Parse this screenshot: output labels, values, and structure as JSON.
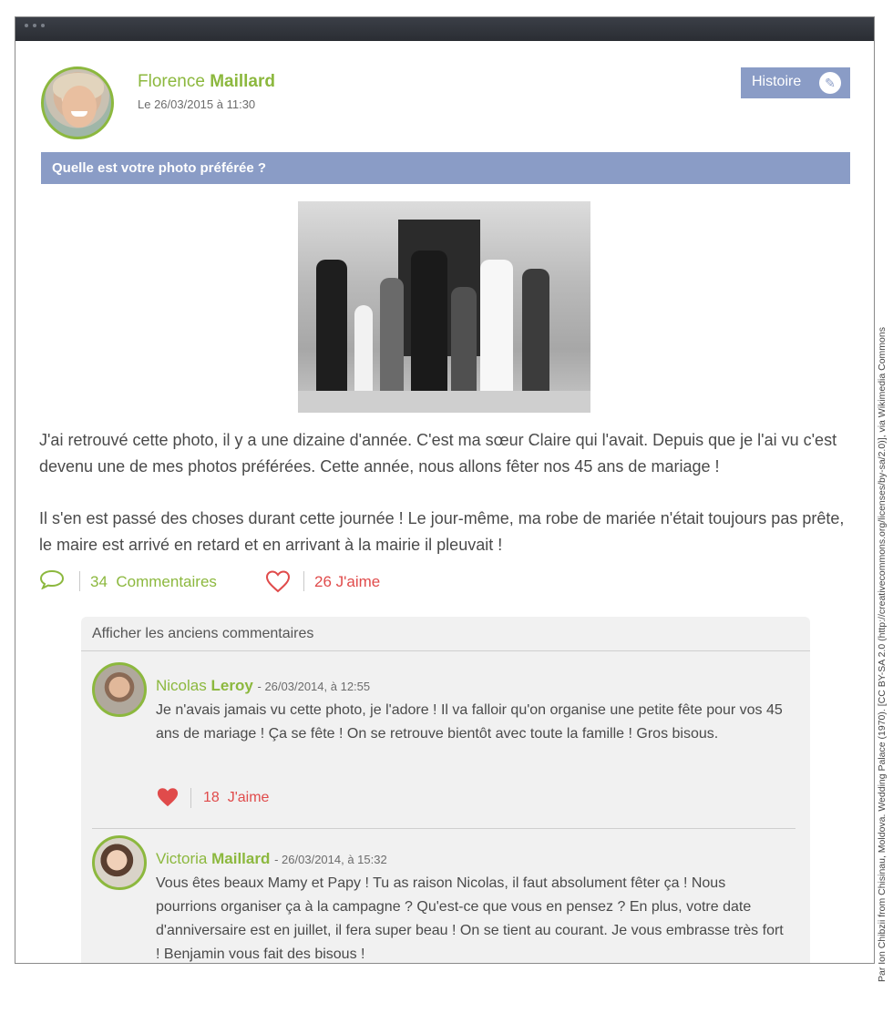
{
  "post": {
    "author_first": "Florence",
    "author_last": "Maillard",
    "date": "Le 26/03/2015 à 11:30",
    "category_button": "Histoire",
    "question": "Quelle est votre photo préférée ?",
    "paragraphs": [
      "J'ai retrouvé cette photo, il y a une dizaine d'année. C'est ma sœur Claire qui l'avait. Depuis que je l'ai vu c'est devenu une de mes photos préférées. Cette année, nous allons fêter nos 45 ans de mariage !",
      "Il s'en est passé des choses durant cette journée ! Le jour-même, ma robe de mariée n'était toujours pas prête, le maire est arrivé en retard et en arrivant à la mairie il pleuvait !"
    ],
    "comments_count": "34",
    "comments_label": "Commentaires",
    "likes_count": "26",
    "likes_label": "J'aime"
  },
  "comments_section": {
    "show_older": "Afficher les anciens commentaires",
    "items": [
      {
        "first": "Nicolas",
        "last": "Leroy",
        "date": "- 26/03/2014, à 12:55",
        "text": "Je n'avais jamais vu cette photo, je l'adore ! Il va falloir qu'on organise une petite fête pour vos 45 ans de mariage ! Ça se fête ! On se retrouve bientôt avec toute la famille ! Gros bisous.",
        "likes": "18",
        "likes_label": "J'aime"
      },
      {
        "first": "Victoria",
        "last": "Maillard",
        "date": "- 26/03/2014, à 15:32",
        "text": "Vous êtes beaux Mamy et Papy ! Tu as raison Nicolas, il faut absolument fêter ça ! Nous pourrions organiser ça à la campagne ? Qu'est-ce que vous en pensez ? En plus, votre date d'anniversaire est en juillet, il fera super beau ! On se tient au courant. Je vous embrasse très fort ! Benjamin vous fait des bisous !"
      }
    ]
  },
  "credit": "Par Ion Chibzii from Chisinau, Moldova. Wedding Palace (1970). [CC BY-SA 2.0 (http://creativecommons.org/licenses/by-sa/2.0)], via Wikimedia Commons",
  "colors": {
    "accent_green": "#8cb83e",
    "accent_blue": "#8a9cc6",
    "like_red": "#e04b4b"
  },
  "icons": [
    "comment-icon",
    "heart-outline-icon",
    "heart-filled-icon",
    "pencil-icon"
  ]
}
